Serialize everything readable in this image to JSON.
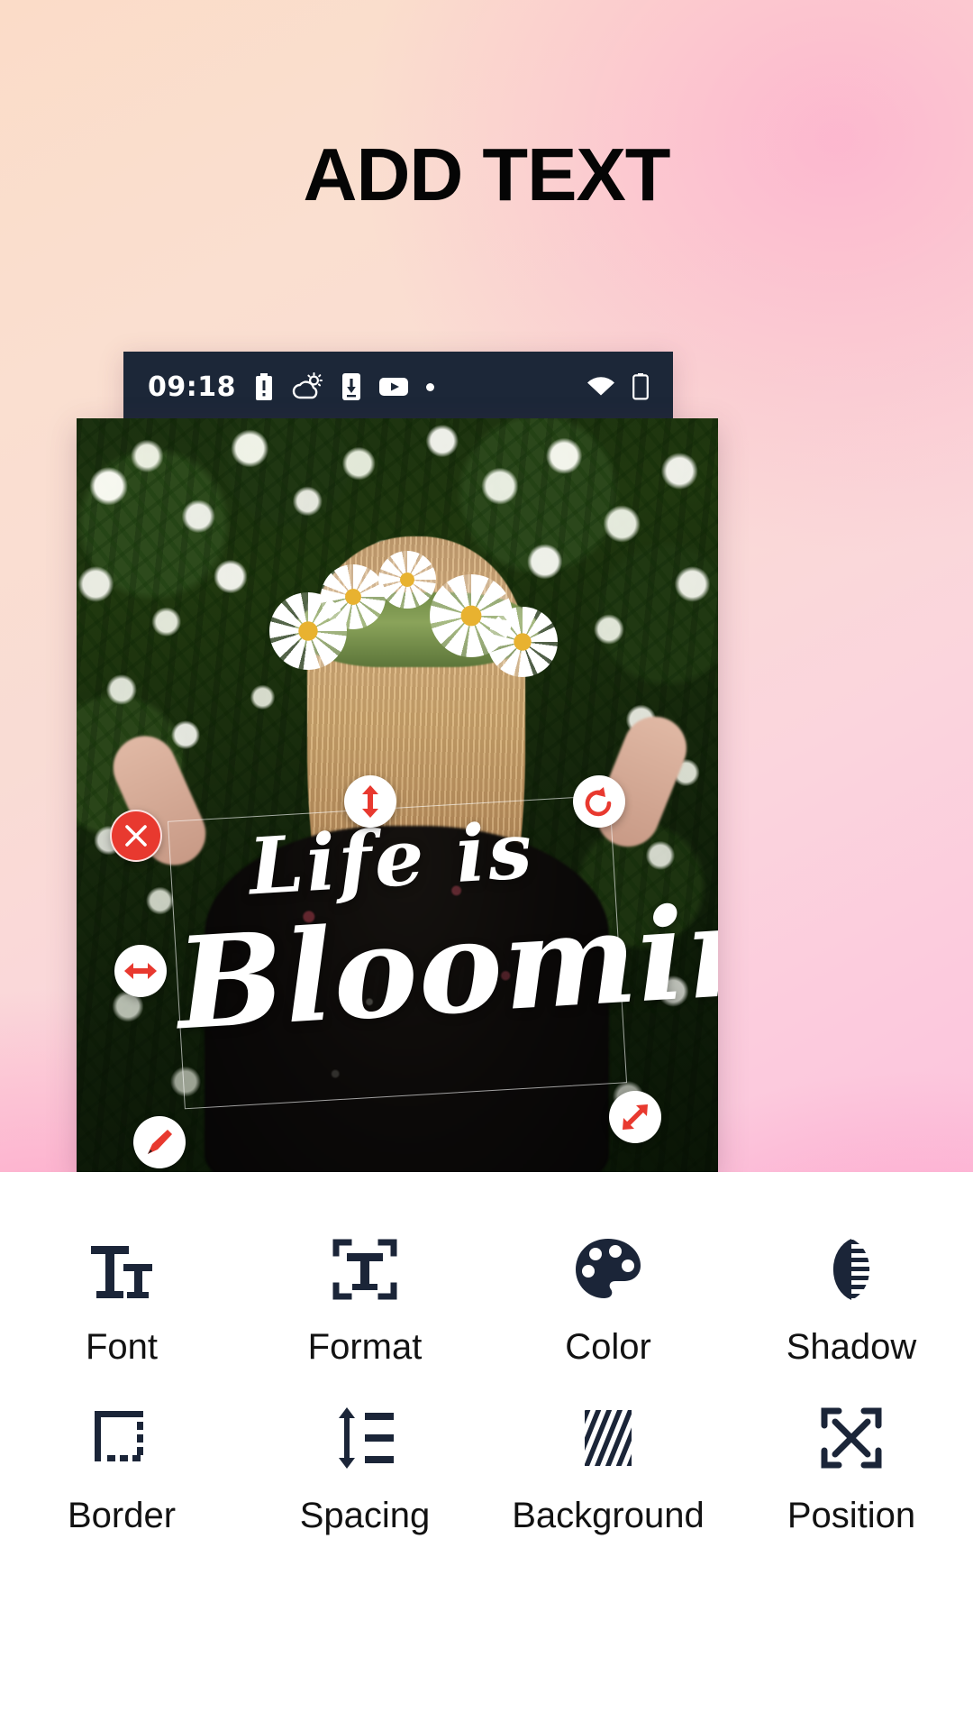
{
  "page": {
    "title": "ADD TEXT",
    "background_gradient": [
      "#fbdcc8",
      "#fcb6d9"
    ]
  },
  "phone": {
    "bar_color": "#1c2738",
    "status_bar": {
      "clock": "09:18",
      "left_icons": [
        "battery-alert-icon",
        "weather-partly-cloudy-icon",
        "download-to-phone-icon",
        "youtube-icon",
        "more-dot-icon"
      ],
      "right_icons": [
        "wifi-icon",
        "battery-icon"
      ]
    },
    "nav_bar": {
      "back_icon": "chevron-left-icon",
      "confirm_icon": "check-icon"
    }
  },
  "editor": {
    "text_overlay": {
      "line1": "Life is",
      "line2": "Blooming",
      "color": "#ffffff",
      "selection_border_color": "rgba(255,255,255,0.62)"
    },
    "handle_color_red": "#e8392f",
    "handle_color_white": "#ffffff",
    "handles": [
      {
        "name": "rotate-handle",
        "icon": "rotate-ccw-icon"
      },
      {
        "name": "move-vertical-handle",
        "icon": "arrows-vertical-icon"
      },
      {
        "name": "delete-handle",
        "icon": "close-x-icon"
      },
      {
        "name": "resize-horizontal-handle",
        "icon": "arrows-horizontal-icon"
      },
      {
        "name": "edit-handle",
        "icon": "pencil-icon"
      },
      {
        "name": "resize-diagonal-handle",
        "icon": "arrows-diagonal-icon"
      }
    ]
  },
  "toolbar": {
    "icon_color": "#1b2538",
    "label_color": "#121212",
    "rows": [
      [
        {
          "label": "Font",
          "icon": "font-size-icon",
          "name": "tool-font"
        },
        {
          "label": "Format",
          "icon": "text-format-icon",
          "name": "tool-format"
        },
        {
          "label": "Color",
          "icon": "color-palette-icon",
          "name": "tool-color"
        },
        {
          "label": "Shadow",
          "icon": "shadow-icon",
          "name": "tool-shadow"
        }
      ],
      [
        {
          "label": "Border",
          "icon": "border-icon",
          "name": "tool-border"
        },
        {
          "label": "Spacing",
          "icon": "line-spacing-icon",
          "name": "tool-spacing"
        },
        {
          "label": "Background",
          "icon": "hatch-background-icon",
          "name": "tool-background"
        },
        {
          "label": "Position",
          "icon": "expand-arrows-icon",
          "name": "tool-position"
        }
      ]
    ]
  }
}
